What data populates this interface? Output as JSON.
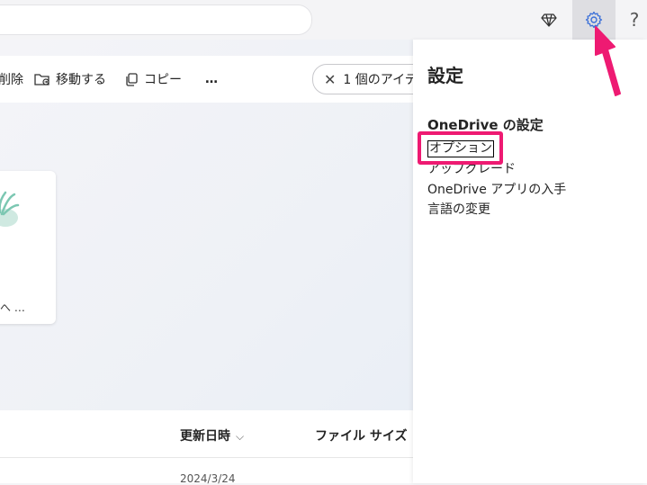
{
  "toolbar": {
    "delete_label": "削除",
    "move_label": "移動する",
    "copy_label": "コピー",
    "more_label": "…",
    "selection_label": "1 個のアイテ"
  },
  "card": {
    "name": "へ …"
  },
  "list": {
    "columns": {
      "modified": "更新日時",
      "size": "ファイル サイズ"
    },
    "rows": [
      {
        "modified": "2024/3/24"
      }
    ]
  },
  "settings": {
    "title": "設定",
    "section": "OneDrive の設定",
    "links": [
      "オプション",
      "アップグレード",
      "OneDrive アプリの入手",
      "言語の変更"
    ]
  },
  "header": {
    "help_label": "?"
  },
  "colors": {
    "highlight": "#ee1a72",
    "panel": "#ffffff"
  }
}
